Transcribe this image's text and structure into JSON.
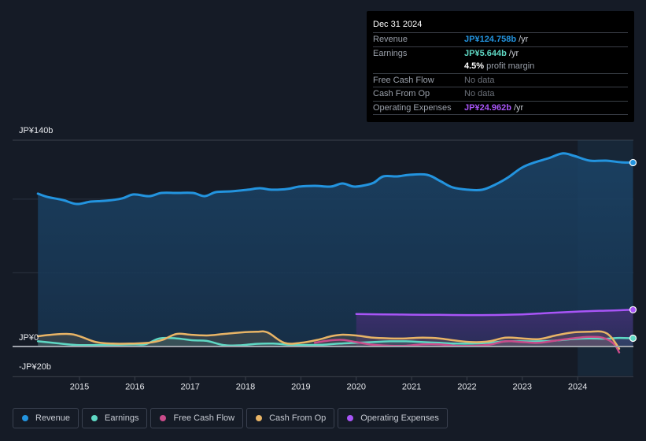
{
  "tooltip": {
    "date": "Dec 31 2024",
    "rows": [
      {
        "label": "Revenue",
        "value": "JP¥124.758b",
        "suffix": " /yr",
        "color": "#2394df"
      },
      {
        "label": "Earnings",
        "value": "JP¥5.644b",
        "suffix": " /yr",
        "color": "#5fd8c4"
      },
      {
        "label": "",
        "value": "4.5%",
        "suffix": " profit margin",
        "color": "#ffffff"
      },
      {
        "label": "Free Cash Flow",
        "value": "No data",
        "suffix": "",
        "color": "#6b7079"
      },
      {
        "label": "Cash From Op",
        "value": "No data",
        "suffix": "",
        "color": "#6b7079"
      },
      {
        "label": "Operating Expenses",
        "value": "JP¥24.962b",
        "suffix": " /yr",
        "color": "#a855f7"
      }
    ]
  },
  "legend": [
    {
      "label": "Revenue",
      "color": "#2394df"
    },
    {
      "label": "Earnings",
      "color": "#5fd8c4"
    },
    {
      "label": "Free Cash Flow",
      "color": "#c94b8a"
    },
    {
      "label": "Cash From Op",
      "color": "#e8b466"
    },
    {
      "label": "Operating Expenses",
      "color": "#a855f7"
    }
  ],
  "chart_data": {
    "type": "area",
    "title": "",
    "xlabel": "",
    "ylabel": "",
    "y_unit": "JP¥ billions",
    "ylim": [
      -20,
      140
    ],
    "xlim": [
      2014.25,
      2025.0
    ],
    "y_tick_labels": [
      {
        "value": 140,
        "label": "JP¥140b"
      },
      {
        "value": 0,
        "label": "JP¥0"
      },
      {
        "value": -20,
        "label": "-JP¥20b"
      }
    ],
    "gridlines": [
      140,
      100,
      50,
      0
    ],
    "x_ticks": [
      2015,
      2016,
      2017,
      2018,
      2019,
      2020,
      2021,
      2022,
      2023,
      2024
    ],
    "highlight_range": [
      2024.0,
      2025.0
    ],
    "series": [
      {
        "name": "Revenue",
        "color": "#2394df",
        "end_marker": true,
        "x": [
          2014.25,
          2014.42,
          2014.7,
          2014.95,
          2015.2,
          2015.48,
          2015.77,
          2015.98,
          2016.26,
          2016.48,
          2016.76,
          2017.05,
          2017.26,
          2017.47,
          2017.76,
          2018.04,
          2018.26,
          2018.47,
          2018.76,
          2018.97,
          2019.25,
          2019.54,
          2019.75,
          2019.96,
          2020.18,
          2020.32,
          2020.49,
          2020.74,
          2020.96,
          2021.28,
          2021.52,
          2021.74,
          2022.02,
          2022.28,
          2022.52,
          2022.73,
          2022.99,
          2023.23,
          2023.47,
          2023.73,
          2023.94,
          2024.22,
          2024.51,
          2024.79,
          2025.0
        ],
        "values": [
          103.7,
          101.5,
          99.4,
          96.7,
          98.3,
          98.9,
          100.5,
          103.2,
          102.0,
          104.2,
          104.2,
          104.2,
          102.0,
          104.8,
          105.3,
          106.4,
          107.4,
          106.4,
          106.9,
          108.5,
          109.0,
          108.5,
          110.6,
          108.5,
          109.6,
          111.2,
          115.4,
          115.4,
          116.5,
          116.5,
          112.2,
          108.0,
          106.4,
          106.4,
          110.0,
          114.4,
          121.3,
          125.0,
          127.7,
          131.0,
          129.3,
          126.1,
          126.1,
          125.0,
          124.8
        ]
      },
      {
        "name": "Earnings",
        "color": "#5fd8c4",
        "end_marker": true,
        "x": [
          2014.25,
          2014.6,
          2014.95,
          2015.3,
          2015.7,
          2016.0,
          2016.2,
          2016.45,
          2016.75,
          2017.05,
          2017.3,
          2017.6,
          2017.9,
          2018.2,
          2018.5,
          2018.8,
          2019.1,
          2019.4,
          2019.7,
          2020.0,
          2020.3,
          2020.6,
          2020.9,
          2021.2,
          2021.5,
          2021.8,
          2022.1,
          2022.4,
          2022.7,
          2023.0,
          2023.3,
          2023.6,
          2023.9,
          2024.2,
          2024.5,
          2024.75,
          2025.0
        ],
        "values": [
          3.5,
          2.2,
          1.0,
          1.0,
          1.2,
          1.4,
          1.6,
          5.5,
          5.5,
          4.2,
          3.8,
          1.0,
          0.8,
          1.8,
          2.0,
          1.2,
          1.0,
          1.2,
          2.0,
          2.5,
          3.0,
          3.5,
          3.5,
          3.0,
          2.5,
          2.0,
          2.0,
          2.5,
          3.5,
          3.5,
          3.5,
          4.0,
          5.0,
          5.5,
          5.3,
          5.8,
          5.6
        ]
      },
      {
        "name": "Free Cash Flow",
        "color": "#c94b8a",
        "end_marker": false,
        "x": [
          2019.25,
          2019.5,
          2019.75,
          2020.0,
          2020.3,
          2020.6,
          2020.9,
          2021.2,
          2021.5,
          2021.8,
          2022.1,
          2022.4,
          2022.7,
          2023.0,
          2023.3,
          2023.6,
          2023.9,
          2024.2,
          2024.45,
          2024.65,
          2024.75
        ],
        "values": [
          2.5,
          4.0,
          4.5,
          3.0,
          1.2,
          0.5,
          0.5,
          1.5,
          1.5,
          0.5,
          0.5,
          1.2,
          3.5,
          3.0,
          2.5,
          4.0,
          5.5,
          6.5,
          6.0,
          2.0,
          -4.0
        ]
      },
      {
        "name": "Cash From Op",
        "color": "#e8b466",
        "end_marker": false,
        "x": [
          2014.25,
          2014.5,
          2014.8,
          2015.0,
          2015.3,
          2015.6,
          2015.9,
          2016.25,
          2016.5,
          2016.75,
          2017.0,
          2017.3,
          2017.6,
          2017.9,
          2018.2,
          2018.4,
          2018.7,
          2019.0,
          2019.3,
          2019.55,
          2019.75,
          2020.0,
          2020.3,
          2020.6,
          2020.9,
          2021.2,
          2021.5,
          2021.8,
          2022.1,
          2022.4,
          2022.7,
          2023.0,
          2023.3,
          2023.6,
          2023.9,
          2024.2,
          2024.45,
          2024.6,
          2024.75
        ],
        "values": [
          7.0,
          8.0,
          8.5,
          7.0,
          3.0,
          2.0,
          2.0,
          2.5,
          4.5,
          8.5,
          8.0,
          7.5,
          8.5,
          9.5,
          10.0,
          9.5,
          2.5,
          2.5,
          4.5,
          7.0,
          8.0,
          7.5,
          6.0,
          5.5,
          5.5,
          6.0,
          5.5,
          4.0,
          3.0,
          3.5,
          6.0,
          5.5,
          5.0,
          7.5,
          9.5,
          10.0,
          10.0,
          6.5,
          -1.5
        ]
      },
      {
        "name": "Operating Expenses",
        "color": "#a855f7",
        "end_marker": true,
        "x": [
          2020.0,
          2020.5,
          2021.0,
          2021.5,
          2022.0,
          2022.5,
          2023.0,
          2023.3,
          2023.6,
          2023.9,
          2024.2,
          2024.5,
          2024.75,
          2025.0
        ],
        "values": [
          22.0,
          21.8,
          21.6,
          21.5,
          21.3,
          21.4,
          21.8,
          22.4,
          23.0,
          23.5,
          24.0,
          24.3,
          24.6,
          24.96
        ]
      }
    ]
  }
}
